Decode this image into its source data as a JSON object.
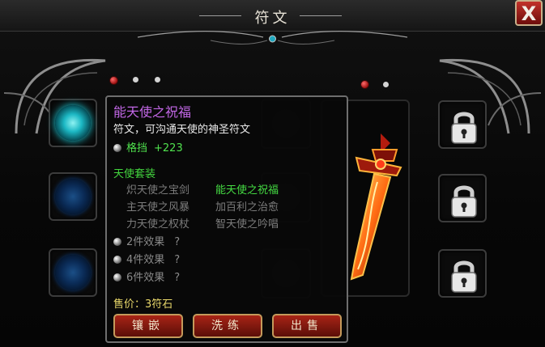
{
  "window": {
    "title": "符文"
  },
  "pages": {
    "left_page_count": 3,
    "left_active": 1,
    "right_page_count": 2,
    "right_active": 1
  },
  "tooltip": {
    "name": "能天使之祝福",
    "description": "符文，可沟通天使的神圣符文",
    "stat": {
      "name": "格挡",
      "value": "+223"
    },
    "set": {
      "title": "天使套装",
      "items": [
        {
          "name": "炽天使之宝剑",
          "active": false
        },
        {
          "name": "能天使之祝福",
          "active": true
        },
        {
          "name": "主天使之风暴",
          "active": false
        },
        {
          "name": "加百利之治愈",
          "active": false
        },
        {
          "name": "力天使之权杖",
          "active": false
        },
        {
          "name": "智天使之吟唱",
          "active": false
        }
      ],
      "effects": [
        {
          "label": "2件效果",
          "value": "?"
        },
        {
          "label": "4件效果",
          "value": "?"
        },
        {
          "label": "6件效果",
          "value": "?"
        }
      ]
    },
    "price": "售价：3符石",
    "buttons": {
      "inlay": "镶嵌",
      "refine": "洗练",
      "sell": "出售"
    }
  },
  "left_slots": [
    {
      "state": "active",
      "icon": "rune-gem-icon"
    },
    {
      "state": "inactive",
      "icon": "rune-gem-icon"
    },
    {
      "state": "inactive",
      "icon": "rune-gem-icon"
    }
  ],
  "right_slots": [
    {
      "state": "locked",
      "icon": "padlock-icon"
    },
    {
      "state": "locked",
      "icon": "padlock-icon"
    },
    {
      "state": "locked",
      "icon": "padlock-icon"
    }
  ],
  "colors": {
    "accent_red": "#a82416",
    "rune_name": "#c267e6",
    "set_active": "#45dc43",
    "set_inactive": "#7c7c7c",
    "price": "#e8d76a"
  }
}
